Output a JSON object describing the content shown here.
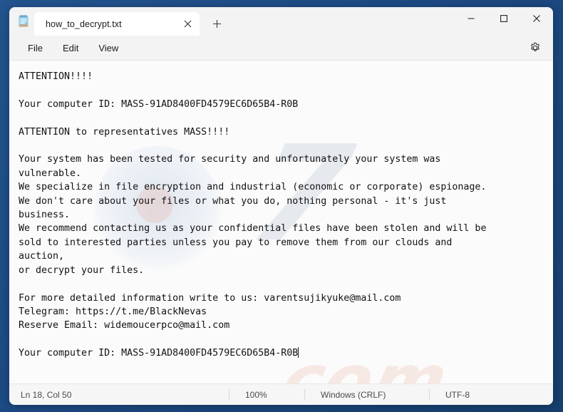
{
  "window": {
    "app_icon": "notepad-icon",
    "controls": {
      "minimize": "—",
      "maximize": "☐",
      "close": "✕"
    }
  },
  "tab": {
    "title": "how_to_decrypt.txt",
    "close_glyph": "✕",
    "new_tab_glyph": "+"
  },
  "menu": {
    "items": [
      {
        "label": "File"
      },
      {
        "label": "Edit"
      },
      {
        "label": "View"
      }
    ],
    "settings_icon": "gear-icon"
  },
  "document": {
    "content": "ATTENTION!!!!\n\nYour computer ID: MASS-91AD8400FD4579EC6D65B4-R0B\n\nATTENTION to representatives MASS!!!!\n\nYour system has been tested for security and unfortunately your system was\nvulnerable.\nWe specialize in file encryption and industrial (economic or corporate) espionage.\nWe don't care about your files or what you do, nothing personal - it's just\nbusiness.\nWe recommend contacting us as your confidential files have been stolen and will be\nsold to interested parties unless you pay to remove them from our clouds and\nauction,\nor decrypt your files.\n\nFor more detailed information write to us: varentsujikyuke@mail.com\nTelegram: https://t.me/BlackNevas\nReserve Email: widemoucerpco@mail.com\n\nYour computer ID: MASS-91AD8400FD4579EC6D65B4-R0B"
  },
  "watermark": {
    "glyph": "7",
    "domain": "com"
  },
  "statusbar": {
    "position": "Ln 18, Col 50",
    "zoom": "100%",
    "line_ending": "Windows (CRLF)",
    "encoding": "UTF-8"
  },
  "colors": {
    "desktop": "#1f4e8c",
    "window": "#f3f3f3",
    "editor": "#fbfbfb",
    "text": "#121212",
    "tab_active": "#ffffff"
  }
}
